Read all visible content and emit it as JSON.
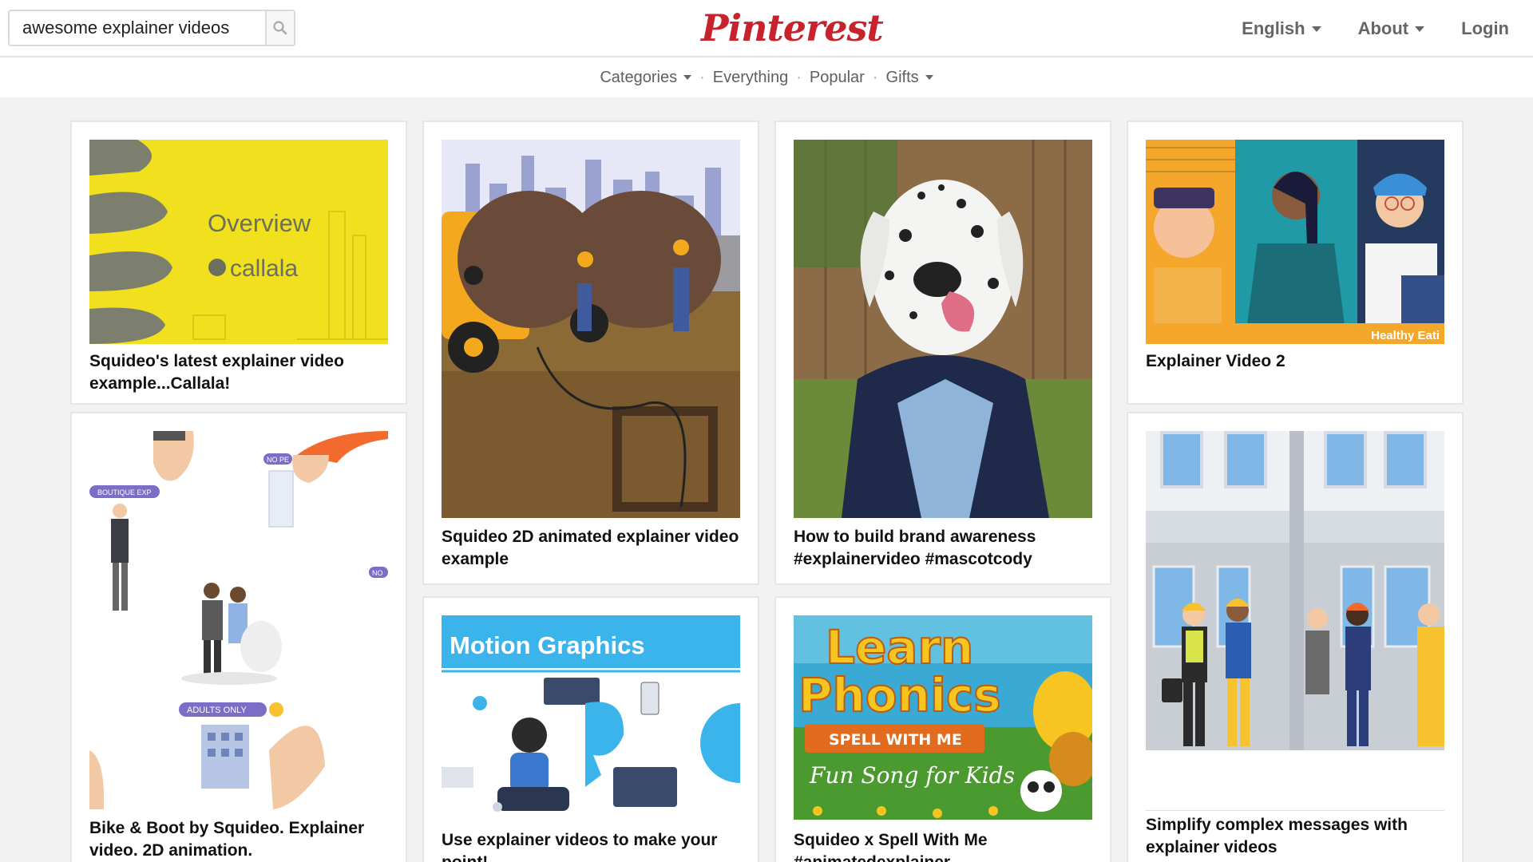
{
  "search": {
    "value": "awesome explainer videos",
    "placeholder": "Search"
  },
  "logo": "Pinterest",
  "topnav": {
    "language": "English",
    "about": "About",
    "login": "Login"
  },
  "subnav": {
    "categories": "Categories",
    "everything": "Everything",
    "popular": "Popular",
    "gifts": "Gifts",
    "separator": "·"
  },
  "pins": [
    {
      "caption": "Squideo's latest explainer video example...Callala!",
      "overlay_title": "Overview",
      "overlay_brand": "callala"
    },
    {
      "caption": "Squideo 2D animated explainer video example"
    },
    {
      "caption": "How to build brand awareness #explainervideo #mascotcody"
    },
    {
      "caption": "Explainer Video 2",
      "overlay_tag": "Healthy Eati"
    },
    {
      "caption": "Bike & Boot by Squideo. Explainer video. 2D animation.",
      "tag_1": "BOUTIQUE EXP",
      "tag_2": "NO PE",
      "tag_3": "ADULTS ONLY",
      "tag_4": "NO"
    },
    {
      "caption": "Use explainer videos to make your point!",
      "banner": "Motion Graphics"
    },
    {
      "caption": "Squideo x Spell With Me #animatedexplainer",
      "title_1": "Learn",
      "title_2": "Phonics",
      "ribbon": "SPELL WITH ME",
      "subtitle": "Fun Song for Kids"
    },
    {
      "caption": "Simplify complex messages with explainer videos"
    }
  ],
  "colors": {
    "brand": "#c8232c",
    "callala_yellow": "#f0e01d",
    "motion_blue": "#3bb4ec"
  }
}
